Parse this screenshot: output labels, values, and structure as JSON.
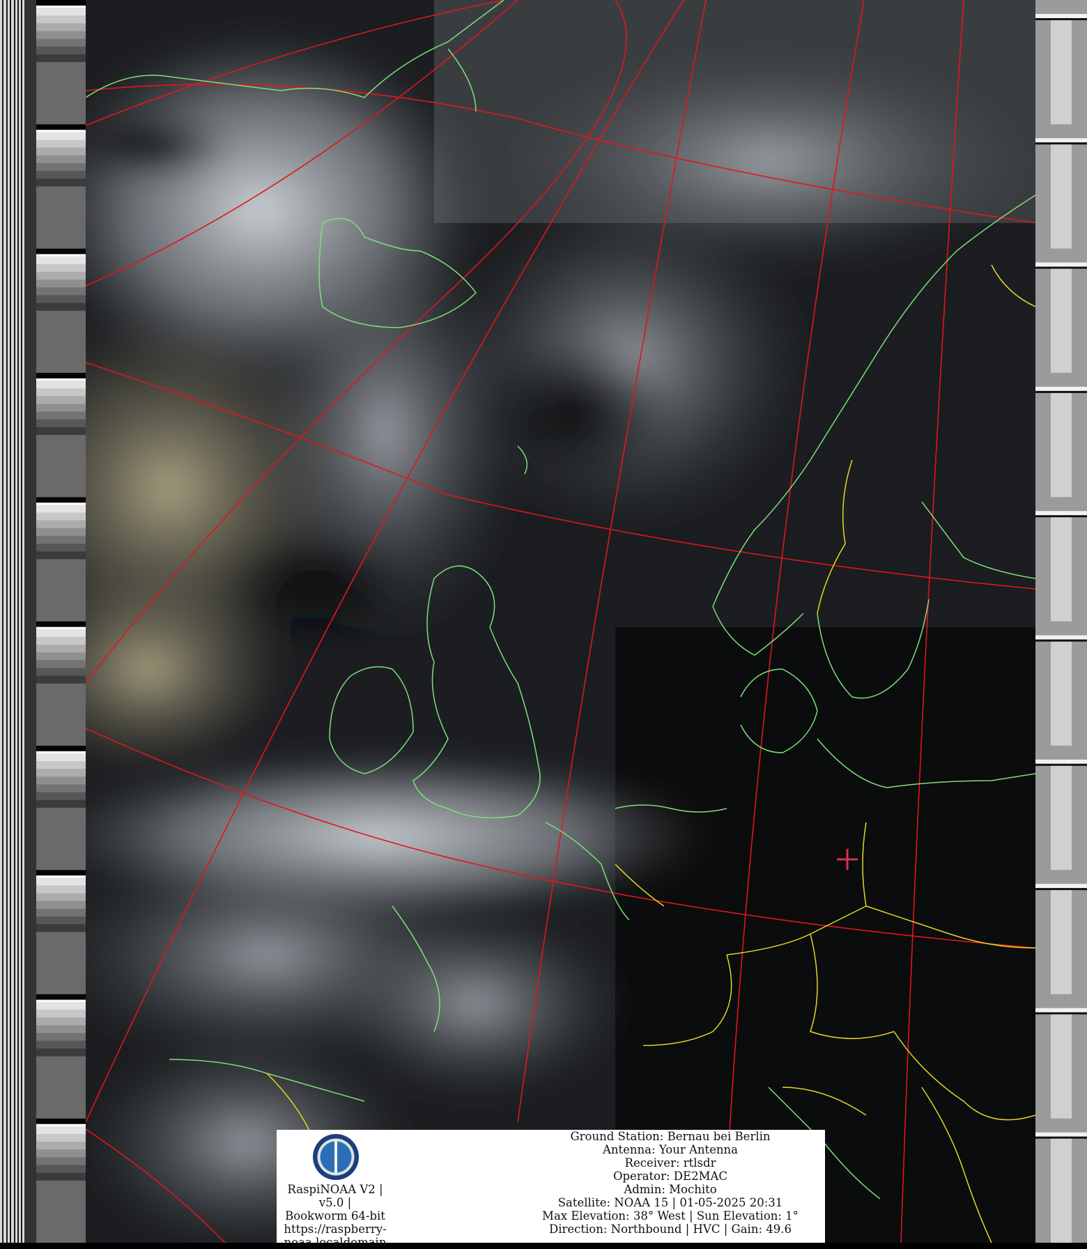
{
  "station": {
    "software_line1": "RaspiNOAA V2 | v5.0 |",
    "software_line2": "Bookworm 64-bit",
    "url_line1": "https://raspberry-",
    "url_line2": "noaa.localdomain"
  },
  "pass_info": {
    "ground_station": "Ground Station: Bernau bei Berlin",
    "antenna": "Antenna: Your Antenna",
    "receiver": "Receiver: rtlsdr",
    "operator": "Operator: DE2MAC",
    "admin": "Admin: Mochito",
    "satellite": "Satellite: NOAA 15 | 01-05-2025 20:31",
    "elevation": "Max Elevation: 38° West | Sun Elevation: 1°",
    "direction": "Direction: Northbound | HVC | Gain: 49.6"
  },
  "colors": {
    "graticule": "#e0161c",
    "coastline": "#7ee07a",
    "borders": "#e6d820",
    "station_marker": "#d8324a"
  }
}
